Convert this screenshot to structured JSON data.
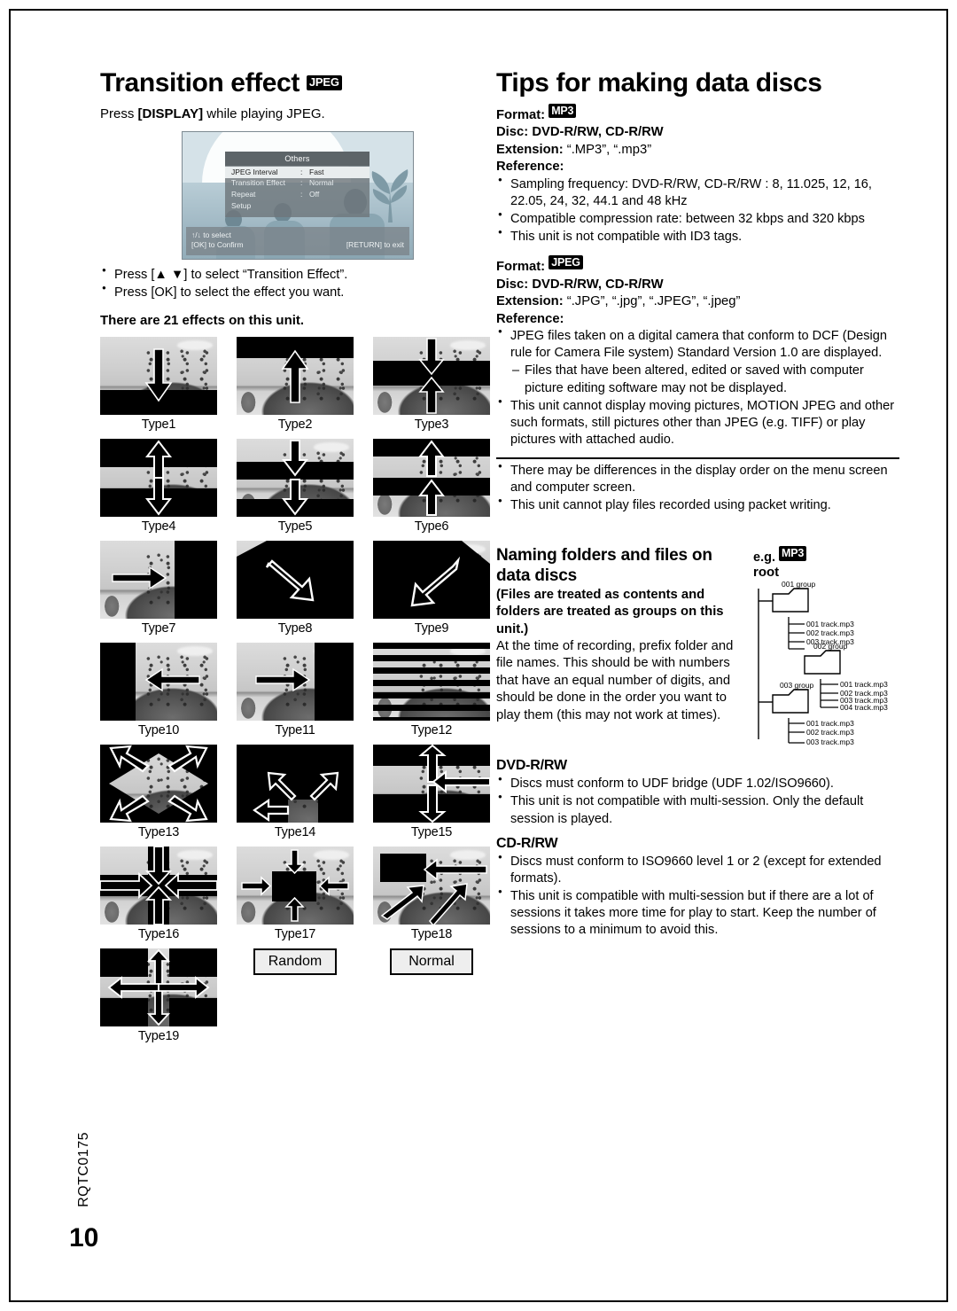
{
  "page": {
    "number": "10",
    "doc_code": "RQTC0175"
  },
  "left": {
    "title": "Transition effect",
    "title_badge": "JPEG",
    "lead_pre": "Press ",
    "lead_key": "[DISPLAY]",
    "lead_post": " while playing JPEG.",
    "osd": {
      "menu_title": "Others",
      "rows": [
        {
          "key": "JPEG Interval",
          "colon": ":",
          "value": "Fast",
          "selected": true
        },
        {
          "key": "Transition Effect",
          "colon": ":",
          "value": "Normal",
          "selected": false
        },
        {
          "key": "Repeat",
          "colon": ":",
          "value": "Off",
          "selected": false
        },
        {
          "key": "Setup",
          "colon": "",
          "value": "",
          "selected": false
        }
      ],
      "footer_line1": "↑/↓ to select",
      "footer_ok": "[OK] to Confirm",
      "footer_return": "[RETURN] to exit"
    },
    "bullets": [
      "Press [▲ ▼] to select “Transition Effect”.",
      "Press [OK] to select the effect you want."
    ],
    "effects_note": "There are 21 effects on this unit.",
    "types": [
      {
        "label": "Type1",
        "pattern": "t1"
      },
      {
        "label": "Type2",
        "pattern": "t2"
      },
      {
        "label": "Type3",
        "pattern": "t3"
      },
      {
        "label": "Type4",
        "pattern": "t4"
      },
      {
        "label": "Type5",
        "pattern": "t5"
      },
      {
        "label": "Type6",
        "pattern": "t6"
      },
      {
        "label": "Type7",
        "pattern": "t7"
      },
      {
        "label": "Type8",
        "pattern": "t8"
      },
      {
        "label": "Type9",
        "pattern": "t9"
      },
      {
        "label": "Type10",
        "pattern": "t10"
      },
      {
        "label": "Type11",
        "pattern": "t11"
      },
      {
        "label": "Type12",
        "pattern": "t12"
      },
      {
        "label": "Type13",
        "pattern": "t13"
      },
      {
        "label": "Type14",
        "pattern": "t14"
      },
      {
        "label": "Type15",
        "pattern": "t15"
      },
      {
        "label": "Type16",
        "pattern": "t16"
      },
      {
        "label": "Type17",
        "pattern": "t17"
      },
      {
        "label": "Type18",
        "pattern": "t18"
      },
      {
        "label": "Type19",
        "pattern": "t19"
      }
    ],
    "buttons": {
      "random": "Random",
      "normal": "Normal"
    }
  },
  "right": {
    "title": "Tips for making data discs",
    "mp3": {
      "format_label": "Format:",
      "format_badge": "MP3",
      "disc_label": "Disc:",
      "disc_value": "DVD-R/RW, CD-R/RW",
      "extension_label": "Extension:",
      "extension_value": "“.MP3”, “.mp3”",
      "reference_label": "Reference:",
      "bullets": [
        "Sampling frequency:\nDVD-R/RW, CD-R/RW : 8, 11.025, 12, 16, 22.05, 24, 32, 44.1 and 48 kHz",
        "Compatible compression rate: between 32 kbps and 320 kbps",
        "This unit is not compatible with ID3 tags."
      ]
    },
    "jpeg": {
      "format_label": "Format:",
      "format_badge": "JPEG",
      "disc_label": "Disc:",
      "disc_value": "DVD-R/RW, CD-R/RW",
      "extension_label": "Extension:",
      "extension_value": "“.JPG”, “.jpg”, “.JPEG”, “.jpeg”",
      "reference_label": "Reference:",
      "bullets": [
        "JPEG files taken on a digital camera that conform to DCF (Design rule for Camera File system) Standard Version 1.0 are displayed.",
        "This unit cannot display moving pictures, MOTION JPEG and other such formats, still pictures other than JPEG (e.g. TIFF) or play pictures with attached audio."
      ],
      "sub_bullets": [
        "Files that have been altered, edited or saved with computer picture editing software may not be displayed."
      ]
    },
    "general_bullets": [
      "There may be differences in the display order on the menu screen and computer screen.",
      "This unit cannot play files recorded using packet writing."
    ],
    "naming": {
      "heading": "Naming folders and files on data discs",
      "paren": "(Files are treated as contents and folders are treated as groups on this unit.)",
      "body": "At the time of recording, prefix folder and file names. This should be with numbers that have an equal number of digits, and should be done in the order you want to play them (this may not work at times).",
      "eg_label": "e.g.",
      "eg_badge": "MP3",
      "root_label": "root",
      "tree": [
        {
          "group": "001 group",
          "files": [
            "001 track.mp3",
            "002 track.mp3",
            "003 track.mp3"
          ],
          "child": {
            "group": "002 group",
            "files": [
              "001 track.mp3",
              "002 track.mp3",
              "003 track.mp3",
              "004 track.mp3"
            ]
          }
        },
        {
          "group": "003 group",
          "files": [
            "001 track.mp3",
            "002 track.mp3",
            "003 track.mp3"
          ]
        }
      ]
    },
    "dvd": {
      "heading": "DVD-R/RW",
      "bullets": [
        "Discs must conform to UDF bridge (UDF 1.02/ISO9660).",
        "This unit is not compatible with multi-session. Only the default session is played."
      ]
    },
    "cd": {
      "heading": "CD-R/RW",
      "bullets": [
        "Discs must conform to ISO9660 level 1 or 2 (except for extended formats).",
        "This unit is compatible with multi-session but if there are a lot of sessions it takes more time for play to start. Keep the number of sessions to a minimum to avoid this."
      ]
    }
  }
}
